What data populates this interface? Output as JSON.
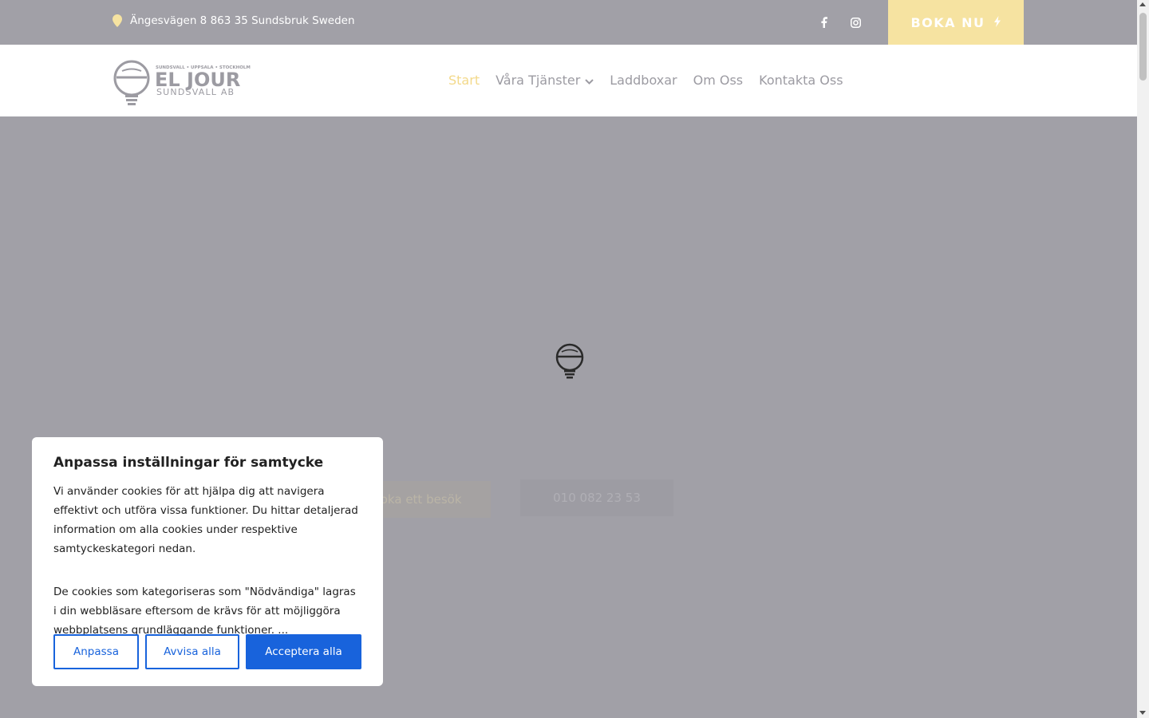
{
  "topbar": {
    "address": "Ängesvägen 8 863 35 Sundsbruk Sweden",
    "book_label": "BOKA NU"
  },
  "logo": {
    "line1": "SUNDSVALL • UPPSALA • STOCKHOLM",
    "line2": "EL JOUR",
    "line3": "SUNDSVALL AB"
  },
  "nav": {
    "items": [
      {
        "label": "Start",
        "active": true
      },
      {
        "label": "Våra Tjänster",
        "dropdown": true
      },
      {
        "label": "Laddboxar"
      },
      {
        "label": "Om Oss"
      },
      {
        "label": "Kontakta Oss"
      }
    ]
  },
  "hero": {
    "button1": "Boka ett besök",
    "button2": "010 082 23 53"
  },
  "cookie": {
    "title": "Anpassa inställningar för samtycke",
    "para1": "Vi använder cookies för att hjälpa dig att navigera effektivt och utföra vissa funktioner. Du hittar detaljerad information om alla cookies under respektive samtyckeskategori nedan.",
    "para2": "De cookies som kategoriseras som \"Nödvändiga\" lagras i din webbläsare eftersom de krävs för att möjliggöra webbplatsens grundläggande funktioner. ...",
    "customize": "Anpassa",
    "reject": "Avvisa alla",
    "accept": "Acceptera alla"
  },
  "colors": {
    "accent": "#f6e3a1",
    "overlay": "#a1a0a7",
    "cookie_blue": "#1863dc"
  }
}
